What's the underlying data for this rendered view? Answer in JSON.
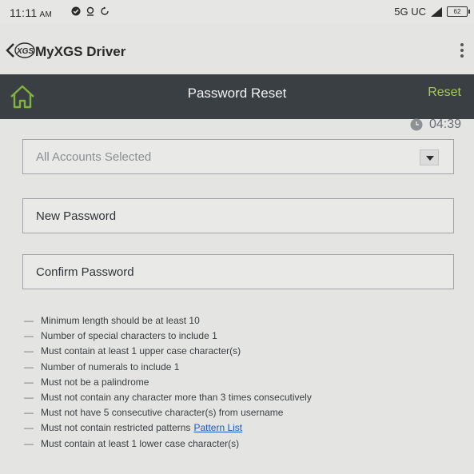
{
  "status_bar": {
    "time": "11:11",
    "ampm": "AM",
    "network": "5G UC",
    "battery": "62"
  },
  "app_bar": {
    "logo_text": "XGS",
    "title": "MyXGS Driver"
  },
  "header": {
    "title": "Password Reset",
    "reset_label": "Reset"
  },
  "timer": {
    "value": "04:39"
  },
  "form": {
    "account_select": {
      "value": "All Accounts Selected"
    },
    "new_password": {
      "label": "New Password"
    },
    "confirm_password": {
      "label": "Confirm Password"
    }
  },
  "rules": [
    {
      "text": "Minimum length should be at least 10"
    },
    {
      "text": "Number of special characters to include 1"
    },
    {
      "text": "Must contain at least 1 upper case character(s)"
    },
    {
      "text": "Number of numerals to include 1"
    },
    {
      "text": "Must not be a palindrome"
    },
    {
      "text": "Must not contain any character more than 3 times consecutively"
    },
    {
      "text": "Must not have 5 consecutive character(s) from username"
    },
    {
      "text": "Must not contain restricted patterns",
      "link": "Pattern List"
    },
    {
      "text": "Must contain at least 1 lower case character(s)"
    }
  ],
  "dash": "—",
  "colors": {
    "header_bg": "#3a3f44",
    "accent_green": "#a3c95a",
    "link_blue": "#1b58c7"
  }
}
